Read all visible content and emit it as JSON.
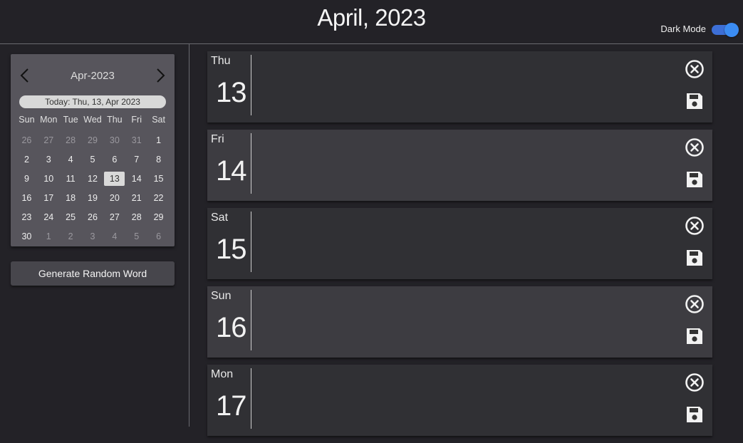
{
  "header": {
    "title": "April, 2023",
    "dark_mode_label": "Dark Mode",
    "dark_mode_on": true
  },
  "calendar": {
    "month_label": "Apr-2023",
    "today_label": "Today: Thu, 13, Apr 2023",
    "weekdays": [
      "Sun",
      "Mon",
      "Tue",
      "Wed",
      "Thu",
      "Fri",
      "Sat"
    ],
    "weeks": [
      [
        "26",
        "27",
        "28",
        "29",
        "30",
        "31",
        "1"
      ],
      [
        "2",
        "3",
        "4",
        "5",
        "6",
        "7",
        "8"
      ],
      [
        "9",
        "10",
        "11",
        "12",
        "13",
        "14",
        "15"
      ],
      [
        "16",
        "17",
        "18",
        "19",
        "20",
        "21",
        "22"
      ],
      [
        "23",
        "24",
        "25",
        "26",
        "27",
        "28",
        "29"
      ],
      [
        "30",
        "1",
        "2",
        "3",
        "4",
        "5",
        "6"
      ]
    ],
    "selected_day": "13"
  },
  "sidebar": {
    "generate_button_label": "Generate Random Word"
  },
  "days": [
    {
      "weekday": "Thu",
      "day": "13"
    },
    {
      "weekday": "Fri",
      "day": "14"
    },
    {
      "weekday": "Sat",
      "day": "15"
    },
    {
      "weekday": "Sun",
      "day": "16"
    },
    {
      "weekday": "Mon",
      "day": "17"
    }
  ],
  "colors": {
    "accent": "#3b8cf2",
    "background": "#232227"
  }
}
